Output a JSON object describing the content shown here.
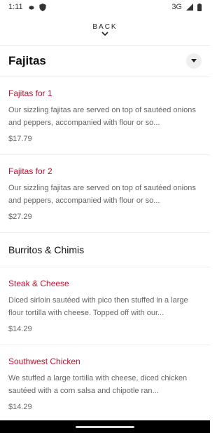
{
  "status": {
    "time": "1:11",
    "network": "3G",
    "icons": [
      "settings-icon",
      "shield-icon",
      "signal-icon",
      "battery-icon"
    ]
  },
  "nav": {
    "back_label": "BACK"
  },
  "category": {
    "title": "Fajitas"
  },
  "items": [
    {
      "name": "Fajitas for 1",
      "description": "Our sizzling fajitas are served on top of sautéed onions and peppers, accompanied with flour or so...",
      "price": "$17.79"
    },
    {
      "name": "Fajitas for 2",
      "description": "Our sizzling fajitas are served on top of sautéed onions and peppers, accompanied with flour or so...",
      "price": "$27.29"
    }
  ],
  "section2": {
    "title": "Burritos & Chimis",
    "items": [
      {
        "name": "Steak & Cheese",
        "description": "Diced sirloin sautéed with pico then stuffed in a large flour tortilla with cheese. Topped off with our...",
        "price": "$14.29"
      },
      {
        "name": "Southwest Chicken",
        "description": "We stuffed a large tortilla with cheese, diced chicken sautéed with a corn salsa and chipotle ran...",
        "price": "$14.29"
      }
    ]
  },
  "colors": {
    "accent": "#c8102e",
    "text": "#222222",
    "muted": "#666666"
  }
}
